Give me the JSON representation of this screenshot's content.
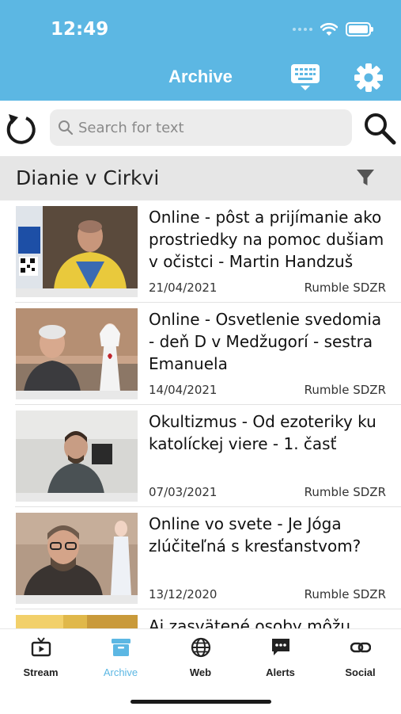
{
  "status_bar": {
    "time": "12:49"
  },
  "header": {
    "title": "Archive",
    "keyboard_icon": "keyboard-icon",
    "settings_icon": "gear-icon"
  },
  "search": {
    "placeholder": "Search for text",
    "value": ""
  },
  "filter": {
    "title": "Dianie v Cirkvi",
    "icon": "filter-icon"
  },
  "items": [
    {
      "title": "Online - pôst a prijímanie ako prostriedky na pomoc dušiam v očistci - Martin Handzuš",
      "date": "21/04/2021",
      "source": "Rumble SDZR"
    },
    {
      "title": "Online - Osvetlenie svedomia - deň D v Medžugorí - sestra Emanuela",
      "date": "14/04/2021",
      "source": "Rumble SDZR"
    },
    {
      "title": "Okultizmus - Od ezoteriky ku katolíckej viere - 1. časť",
      "date": "07/03/2021",
      "source": "Rumble SDZR"
    },
    {
      "title": "Online vo svete - Je Jóga zlúčiteľná s kresťanstvom?",
      "date": "13/12/2020",
      "source": "Rumble SDZR"
    },
    {
      "title": "Aj zasvätené osoby môžu",
      "date": "",
      "source": ""
    }
  ],
  "tabs": [
    {
      "label": "Stream",
      "icon": "tv-icon",
      "active": false
    },
    {
      "label": "Archive",
      "icon": "archive-box-icon",
      "active": true
    },
    {
      "label": "Web",
      "icon": "globe-icon",
      "active": false
    },
    {
      "label": "Alerts",
      "icon": "chat-bubble-icon",
      "active": false
    },
    {
      "label": "Social",
      "icon": "link-icon",
      "active": false
    }
  ],
  "colors": {
    "accent": "#5cb7e3",
    "filter_bar": "#e6e6e6",
    "search_bg": "#ececec"
  }
}
